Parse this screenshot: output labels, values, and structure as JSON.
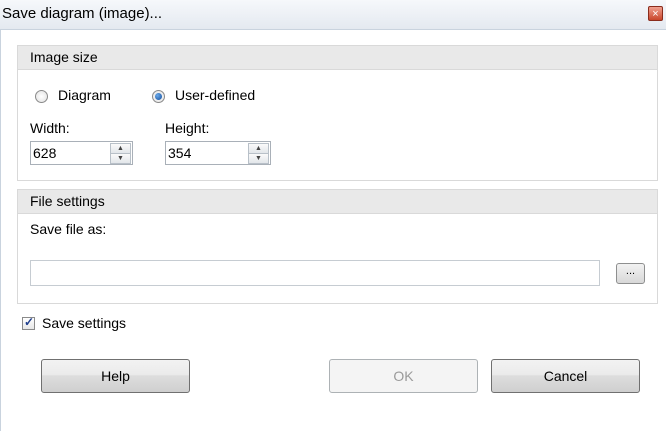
{
  "window": {
    "title": "Save diagram (image)...",
    "close_glyph": "×"
  },
  "image_size": {
    "title": "Image size",
    "options": [
      "Diagram",
      "User-defined"
    ],
    "selected": "User-defined",
    "width": {
      "label": "Width:",
      "value": "628"
    },
    "height": {
      "label": "Height:",
      "value": "354"
    }
  },
  "file_settings": {
    "title": "File settings",
    "save_as_label": "Save file as:",
    "save_as_value": "",
    "browse_label": "..."
  },
  "save_settings": {
    "label": "Save settings",
    "checked": true,
    "check_glyph": "✓"
  },
  "buttons": {
    "help": "Help",
    "ok": "OK",
    "cancel": "Cancel"
  },
  "spinner_glyphs": {
    "up": "▲",
    "down": "▼"
  }
}
